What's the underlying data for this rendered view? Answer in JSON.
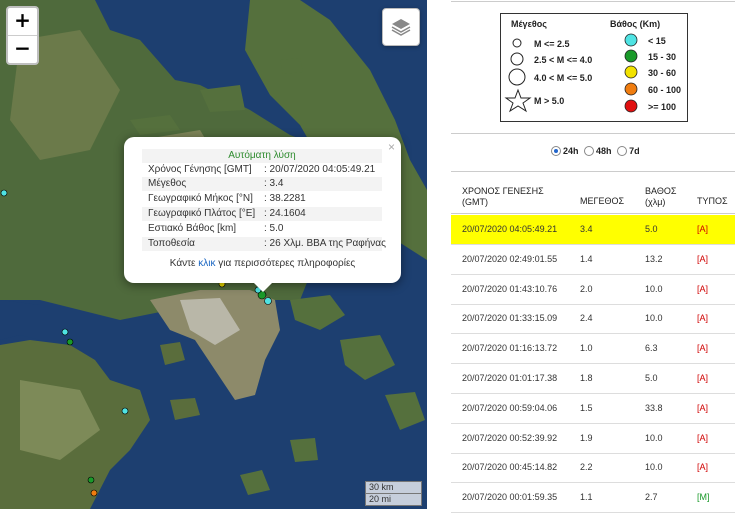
{
  "map": {
    "zoom_in": "+",
    "zoom_out": "−",
    "layers_icon": "layers-icon",
    "popup": {
      "title": "Αυτόματη λύση",
      "rows": [
        {
          "key": "Χρόνος Γένησης [GMT]",
          "value": ": 20/07/2020 04:05:49.21"
        },
        {
          "key": "Μέγεθος",
          "value": ": 3.4"
        },
        {
          "key": "Γεωγραφικό Μήκος [°N]",
          "value": ": 38.2281"
        },
        {
          "key": "Γεωγραφικό Πλάτος [°E]",
          "value": ": 24.1604"
        },
        {
          "key": "Εστιακό Βάθος [km]",
          "value": ": 5.0"
        },
        {
          "key": "Τοποθεσία",
          "value": ": 26 Χλμ. ΒΒΑ της Ραφήνας"
        }
      ],
      "more_before": "Κάντε ",
      "more_link": "κλικ",
      "more_after": " για περισσότερες πληροφορίες",
      "close": "×"
    },
    "scale": {
      "km": "30 km",
      "mi": "20 mi"
    }
  },
  "legend": {
    "magnitude_title": "Μέγεθος",
    "depth_title": "Βάθος (Km)",
    "magnitudes": [
      "M <= 2.5",
      "2.5 < M <= 4.0",
      "4.0 < M <= 5.0",
      "M > 5.0"
    ],
    "depths": [
      {
        "label": "< 15",
        "color": "#4fe3e3"
      },
      {
        "label": "15 - 30",
        "color": "#1a9a2a"
      },
      {
        "label": "30 - 60",
        "color": "#f2e200"
      },
      {
        "label": "60 - 100",
        "color": "#f07d10"
      },
      {
        "label": ">= 100",
        "color": "#e01010"
      }
    ]
  },
  "range": {
    "options": [
      "24h",
      "48h",
      "7d"
    ],
    "selected": "24h"
  },
  "table": {
    "headers": [
      "ΧΡΟΝΟΣ ΓΕΝΕΣΗΣ (GMT)",
      "ΜΕΓΕΘΟΣ",
      "ΒΑΘΟΣ (χλμ)",
      "ΤΥΠΟΣ"
    ],
    "rows": [
      {
        "time": "20/07/2020 04:05:49.21",
        "mag": "3.4",
        "depth": "5.0",
        "type": "[A]"
      },
      {
        "time": "20/07/2020 02:49:01.55",
        "mag": "1.4",
        "depth": "13.2",
        "type": "[A]"
      },
      {
        "time": "20/07/2020 01:43:10.76",
        "mag": "2.0",
        "depth": "10.0",
        "type": "[A]"
      },
      {
        "time": "20/07/2020 01:33:15.09",
        "mag": "2.4",
        "depth": "10.0",
        "type": "[A]"
      },
      {
        "time": "20/07/2020 01:16:13.72",
        "mag": "1.0",
        "depth": "6.3",
        "type": "[A]"
      },
      {
        "time": "20/07/2020 01:01:17.38",
        "mag": "1.8",
        "depth": "5.0",
        "type": "[A]"
      },
      {
        "time": "20/07/2020 00:59:04.06",
        "mag": "1.5",
        "depth": "33.8",
        "type": "[A]"
      },
      {
        "time": "20/07/2020 00:52:39.92",
        "mag": "1.9",
        "depth": "10.0",
        "type": "[A]"
      },
      {
        "time": "20/07/2020 00:45:14.82",
        "mag": "2.2",
        "depth": "10.0",
        "type": "[A]"
      },
      {
        "time": "20/07/2020 00:01:59.35",
        "mag": "1.1",
        "depth": "2.7",
        "type": "[M]"
      }
    ],
    "type_colors": {
      "[A]": "#d00000",
      "[M]": "#1a9a2a"
    },
    "highlight_color": "#ffff00"
  }
}
